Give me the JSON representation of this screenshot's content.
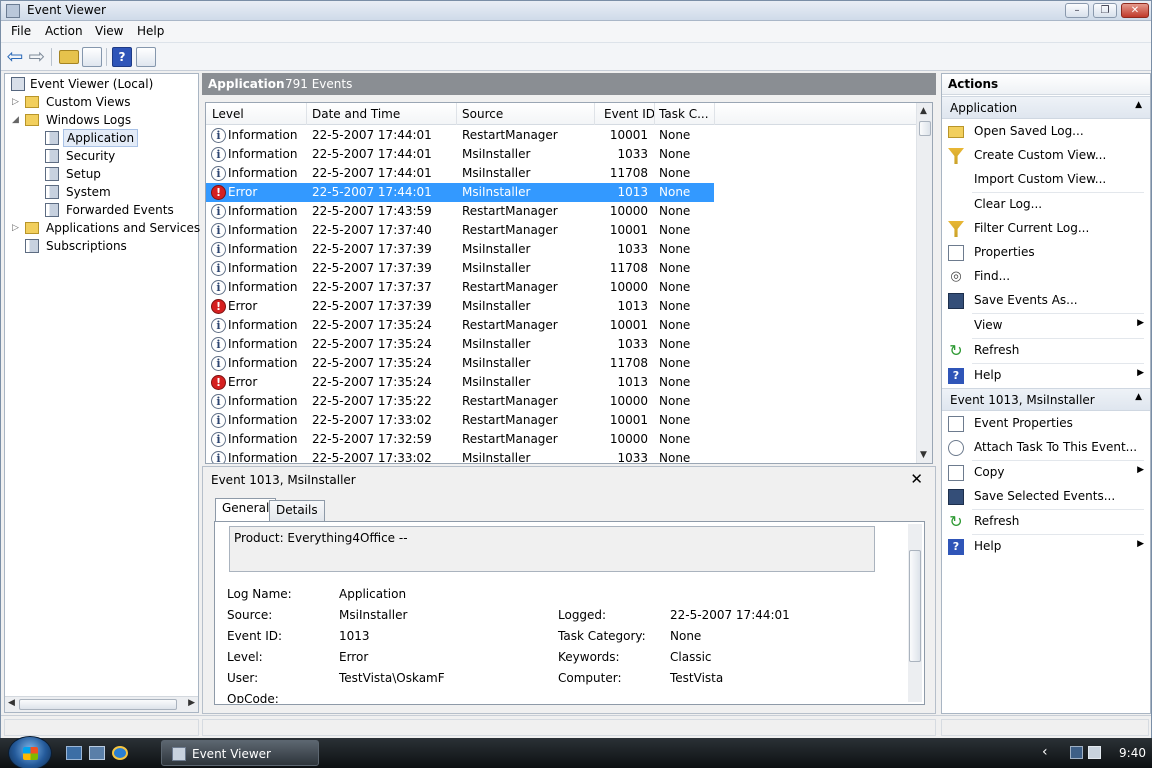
{
  "window": {
    "title": "Event Viewer",
    "min": "–",
    "max": "❐",
    "close": "✕"
  },
  "menu": [
    "File",
    "Action",
    "View",
    "Help"
  ],
  "toolbar": {
    "back": "⇦",
    "forward": "⇨",
    "help": "?"
  },
  "tree": {
    "root": "Event Viewer (Local)",
    "custom_views": "Custom Views",
    "windows_logs": "Windows Logs",
    "logs": [
      "Application",
      "Security",
      "Setup",
      "System",
      "Forwarded Events"
    ],
    "apps_services": "Applications and Services Lo",
    "subscriptions": "Subscriptions",
    "expand_closed": "▷",
    "expand_open": "◢",
    "scroll_left": "◀",
    "scroll_right": "▶"
  },
  "middle": {
    "log_name": "Application",
    "event_count": "791 Events"
  },
  "grid": {
    "columns": [
      "Level",
      "Date and Time",
      "Source",
      "Event ID",
      "Task C..."
    ],
    "rows": [
      {
        "level": "Information",
        "date": "22-5-2007 17:44:01",
        "source": "RestartManager",
        "id": "10001",
        "task": "None"
      },
      {
        "level": "Information",
        "date": "22-5-2007 17:44:01",
        "source": "MsiInstaller",
        "id": "1033",
        "task": "None"
      },
      {
        "level": "Information",
        "date": "22-5-2007 17:44:01",
        "source": "MsiInstaller",
        "id": "11708",
        "task": "None"
      },
      {
        "level": "Error",
        "date": "22-5-2007 17:44:01",
        "source": "MsiInstaller",
        "id": "1013",
        "task": "None",
        "selected": true
      },
      {
        "level": "Information",
        "date": "22-5-2007 17:43:59",
        "source": "RestartManager",
        "id": "10000",
        "task": "None"
      },
      {
        "level": "Information",
        "date": "22-5-2007 17:37:40",
        "source": "RestartManager",
        "id": "10001",
        "task": "None"
      },
      {
        "level": "Information",
        "date": "22-5-2007 17:37:39",
        "source": "MsiInstaller",
        "id": "1033",
        "task": "None"
      },
      {
        "level": "Information",
        "date": "22-5-2007 17:37:39",
        "source": "MsiInstaller",
        "id": "11708",
        "task": "None"
      },
      {
        "level": "Information",
        "date": "22-5-2007 17:37:37",
        "source": "RestartManager",
        "id": "10000",
        "task": "None"
      },
      {
        "level": "Error",
        "date": "22-5-2007 17:37:39",
        "source": "MsiInstaller",
        "id": "1013",
        "task": "None"
      },
      {
        "level": "Information",
        "date": "22-5-2007 17:35:24",
        "source": "RestartManager",
        "id": "10001",
        "task": "None"
      },
      {
        "level": "Information",
        "date": "22-5-2007 17:35:24",
        "source": "MsiInstaller",
        "id": "1033",
        "task": "None"
      },
      {
        "level": "Information",
        "date": "22-5-2007 17:35:24",
        "source": "MsiInstaller",
        "id": "11708",
        "task": "None"
      },
      {
        "level": "Error",
        "date": "22-5-2007 17:35:24",
        "source": "MsiInstaller",
        "id": "1013",
        "task": "None"
      },
      {
        "level": "Information",
        "date": "22-5-2007 17:35:22",
        "source": "RestartManager",
        "id": "10000",
        "task": "None"
      },
      {
        "level": "Information",
        "date": "22-5-2007 17:33:02",
        "source": "RestartManager",
        "id": "10001",
        "task": "None"
      },
      {
        "level": "Information",
        "date": "22-5-2007 17:32:59",
        "source": "RestartManager",
        "id": "10000",
        "task": "None"
      },
      {
        "level": "Information",
        "date": "22-5-2007 17:33:02",
        "source": "MsiInstaller",
        "id": "1033",
        "task": "None"
      }
    ],
    "info_glyph": "i",
    "error_glyph": "!",
    "scroll_up": "▲",
    "scroll_down": "▼"
  },
  "detail": {
    "title": "Event 1013, MsiInstaller",
    "close": "✕",
    "tabs": [
      "General",
      "Details"
    ],
    "message": "Product: Everything4Office --",
    "fields": {
      "log_name_label": "Log Name:",
      "log_name": "Application",
      "source_label": "Source:",
      "source": "MsiInstaller",
      "logged_label": "Logged:",
      "logged": "22-5-2007 17:44:01",
      "event_id_label": "Event ID:",
      "event_id": "1013",
      "task_label": "Task Category:",
      "task": "None",
      "level_label": "Level:",
      "level": "Error",
      "keywords_label": "Keywords:",
      "keywords": "Classic",
      "user_label": "User:",
      "user": "TestVista\\OskamF",
      "computer_label": "Computer:",
      "computer": "TestVista",
      "opcode_label": "OpCode:"
    }
  },
  "actions": {
    "header": "Actions",
    "section1": "Application",
    "section1_items": [
      {
        "label": "Open Saved Log...",
        "icon": "folder-icon"
      },
      {
        "label": "Create Custom View...",
        "icon": "filter-icon"
      },
      {
        "label": "Import Custom View...",
        "icon": ""
      },
      {
        "label": "Clear Log...",
        "icon": ""
      },
      {
        "label": "Filter Current Log...",
        "icon": "filter-icon"
      },
      {
        "label": "Properties",
        "icon": "properties-icon"
      },
      {
        "label": "Find...",
        "icon": "binoculars-icon"
      },
      {
        "label": "Save Events As...",
        "icon": "save-icon"
      },
      {
        "label": "View",
        "icon": "",
        "submenu": true
      },
      {
        "label": "Refresh",
        "icon": "refresh-icon"
      },
      {
        "label": "Help",
        "icon": "help-icon",
        "submenu": true
      }
    ],
    "section2": "Event 1013, MsiInstaller",
    "section2_items": [
      {
        "label": "Event Properties",
        "icon": "properties-icon"
      },
      {
        "label": "Attach Task To This Event...",
        "icon": "task-icon"
      },
      {
        "label": "Copy",
        "icon": "copy-icon",
        "submenu": true
      },
      {
        "label": "Save Selected Events...",
        "icon": "save-icon"
      },
      {
        "label": "Refresh",
        "icon": "refresh-icon"
      },
      {
        "label": "Help",
        "icon": "help-icon",
        "submenu": true
      }
    ],
    "collapse": "▲",
    "submenu_arrow": "▶"
  },
  "taskbar": {
    "window_button": "Event Viewer",
    "clock": "9:40",
    "tray_chevron": "‹"
  }
}
